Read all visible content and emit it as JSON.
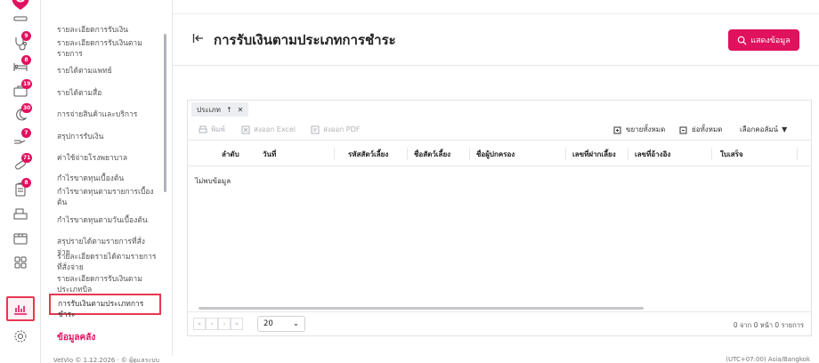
{
  "colors": {
    "accent": "#e0115f",
    "highlight": "#e53950"
  },
  "rail": {
    "items": [
      {
        "icon": "tooth-icon",
        "badge": ""
      },
      {
        "icon": "stethoscope-icon",
        "badge": "9"
      },
      {
        "icon": "bed-icon",
        "badge": "8"
      },
      {
        "icon": "briefcase-icon",
        "badge": "19"
      },
      {
        "icon": "moon-icon",
        "badge": "30"
      },
      {
        "icon": "hand-icon",
        "badge": "7"
      },
      {
        "icon": "pill-icon",
        "badge": "71"
      },
      {
        "icon": "clipboard-icon",
        "badge": "8"
      },
      {
        "icon": "register-icon",
        "badge": ""
      },
      {
        "icon": "box-icon",
        "badge": ""
      },
      {
        "icon": "grid-icon",
        "badge": ""
      },
      {
        "icon": "report-chart-icon",
        "badge": ""
      },
      {
        "icon": "settings-icon",
        "badge": ""
      }
    ]
  },
  "submenu": {
    "items": [
      "รายละเอียดการรับเงิน",
      "รายละเอียดการรับเงินตามรายการ",
      "รายได้ตามแพทย์",
      "รายได้ตามสื่อ",
      "การจ่ายสินค้าและบริการ",
      "สรุปการรับเงิน",
      "ค่าใช้จ่ายโรงพยาบาล",
      "กำไรขาดทุนเบื้องต้น",
      "กำไรขาดทุนตามรายการเบื้องต้น",
      "กำไรขาดทุนตามวันเบื้องต้น",
      "สรุปรายได้ตามรายการที่สั่งจ่าย",
      "รายละเอียดรายได้ตามรายการที่สั่งจ่าย",
      "รายละเอียดการรับเงินตามประเภทบิล",
      "การรับเงินตามประเภทการชำระ"
    ],
    "section": "ข้อมูลคลัง"
  },
  "page": {
    "title": "การรับเงินตามประเภทการชำระ",
    "show_button": "แสดงข้อมูล"
  },
  "grid": {
    "group_chip": "ประเภท",
    "toolbar": {
      "print": "พิมพ์",
      "export_excel": "ส่งออก Excel",
      "export_pdf": "ส่งออก PDF",
      "expand_all": "ขยายทั้งหมด",
      "collapse_all": "ย่อทั้งหมด",
      "choose_columns": "เลือกคอลัมน์"
    },
    "columns": [
      "ลำดับ",
      "วันที่",
      "รหัสสัตว์เลี้ยง",
      "ชื่อสัตว์เลี้ยง",
      "ชื่อผู้ปกครอง",
      "เลขที่ฝากเลี้ยง",
      "เลขที่อ้างอิง",
      "ใบเสร็จ"
    ],
    "empty": "ไม่พบข้อมูล",
    "page_size": "20",
    "page_info": "0 จาก 0 หน้า 0 รายการ"
  },
  "status": {
    "left": "VetVio © 1.12.2026 · © ผู้ดูแลระบบ",
    "right": "(UTC+07:00) Asia/Bangkok"
  }
}
